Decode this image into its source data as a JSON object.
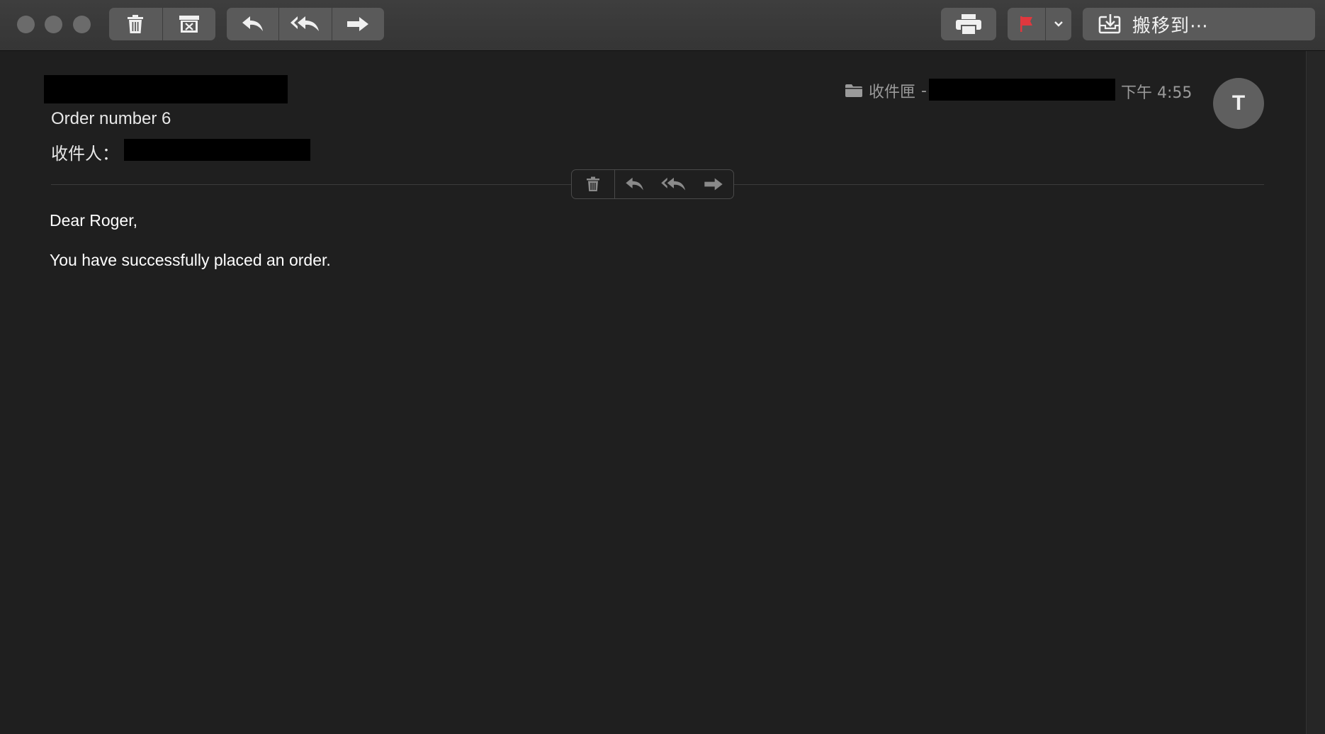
{
  "toolbar": {
    "traffic_lights": [
      "close",
      "minimize",
      "zoom"
    ],
    "icons": {
      "delete": "trash-icon",
      "junk": "archive-x-icon",
      "reply": "reply-icon",
      "reply_all": "reply-all-icon",
      "forward": "forward-icon",
      "print": "printer-icon",
      "flag": "flag-icon",
      "flag_menu": "chevron-down-icon",
      "move": "move-to-icon"
    },
    "move_label": "搬移到⋯",
    "flag_color": "#e0383e",
    "button_color": "#5a5a5a"
  },
  "message": {
    "subject": "Order number 6",
    "to_label": "收件人：",
    "mailbox_label": "收件匣",
    "mailbox_separator": "-",
    "time": "下午 4:55",
    "avatar_initial": "T",
    "body": [
      "Dear Roger,",
      "You have successfully placed an order."
    ]
  },
  "colors": {
    "background": "#1f1f1f",
    "toolbar": "#3a3a3a",
    "text": "#ffffff",
    "muted_text": "#9a9a9a",
    "avatar": "#5f5f5f"
  }
}
